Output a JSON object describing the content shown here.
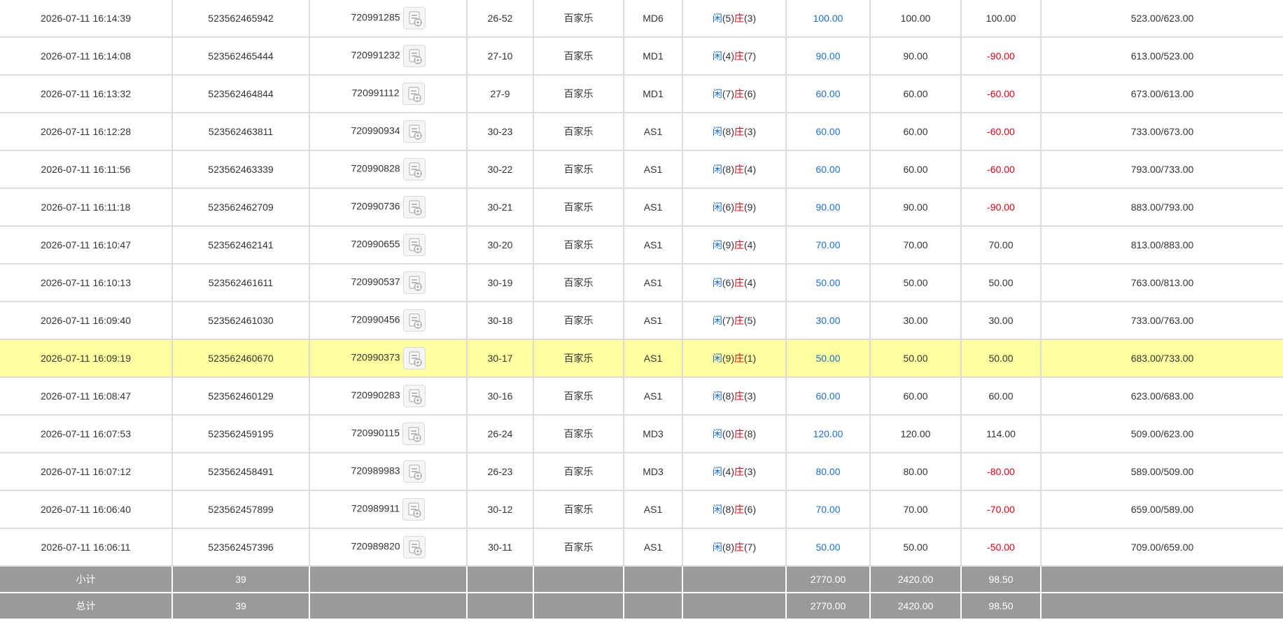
{
  "colors": {
    "player": "#1a6fd6",
    "banker": "#e60012",
    "highlight": "#ffffa0",
    "summary_bg": "#9a9a9a"
  },
  "icons": {
    "detail": "game-detail-icon"
  },
  "rows": [
    {
      "time": "2026-07-11 16:14:39",
      "bet_id": "523562465942",
      "round_id": "720991285",
      "shoe": "26-52",
      "game": "百家乐",
      "table": "MD6",
      "player_label": "闲",
      "player_score": "(5)",
      "banker_label": "庄",
      "banker_score": "(3)",
      "bet": "100.00",
      "valid_bet": "100.00",
      "win_loss": "100.00",
      "win_loss_negative": false,
      "balance": "523.00/623.00",
      "highlight": false
    },
    {
      "time": "2026-07-11 16:14:08",
      "bet_id": "523562465444",
      "round_id": "720991232",
      "shoe": "27-10",
      "game": "百家乐",
      "table": "MD1",
      "player_label": "闲",
      "player_score": "(4)",
      "banker_label": "庄",
      "banker_score": "(7)",
      "bet": "90.00",
      "valid_bet": "90.00",
      "win_loss": "-90.00",
      "win_loss_negative": true,
      "balance": "613.00/523.00",
      "highlight": false
    },
    {
      "time": "2026-07-11 16:13:32",
      "bet_id": "523562464844",
      "round_id": "720991112",
      "shoe": "27-9",
      "game": "百家乐",
      "table": "MD1",
      "player_label": "闲",
      "player_score": "(7)",
      "banker_label": "庄",
      "banker_score": "(6)",
      "bet": "60.00",
      "valid_bet": "60.00",
      "win_loss": "-60.00",
      "win_loss_negative": true,
      "balance": "673.00/613.00",
      "highlight": false
    },
    {
      "time": "2026-07-11 16:12:28",
      "bet_id": "523562463811",
      "round_id": "720990934",
      "shoe": "30-23",
      "game": "百家乐",
      "table": "AS1",
      "player_label": "闲",
      "player_score": "(8)",
      "banker_label": "庄",
      "banker_score": "(3)",
      "bet": "60.00",
      "valid_bet": "60.00",
      "win_loss": "-60.00",
      "win_loss_negative": true,
      "balance": "733.00/673.00",
      "highlight": false
    },
    {
      "time": "2026-07-11 16:11:56",
      "bet_id": "523562463339",
      "round_id": "720990828",
      "shoe": "30-22",
      "game": "百家乐",
      "table": "AS1",
      "player_label": "闲",
      "player_score": "(8)",
      "banker_label": "庄",
      "banker_score": "(4)",
      "bet": "60.00",
      "valid_bet": "60.00",
      "win_loss": "-60.00",
      "win_loss_negative": true,
      "balance": "793.00/733.00",
      "highlight": false
    },
    {
      "time": "2026-07-11 16:11:18",
      "bet_id": "523562462709",
      "round_id": "720990736",
      "shoe": "30-21",
      "game": "百家乐",
      "table": "AS1",
      "player_label": "闲",
      "player_score": "(6)",
      "banker_label": "庄",
      "banker_score": "(9)",
      "bet": "90.00",
      "valid_bet": "90.00",
      "win_loss": "-90.00",
      "win_loss_negative": true,
      "balance": "883.00/793.00",
      "highlight": false
    },
    {
      "time": "2026-07-11 16:10:47",
      "bet_id": "523562462141",
      "round_id": "720990655",
      "shoe": "30-20",
      "game": "百家乐",
      "table": "AS1",
      "player_label": "闲",
      "player_score": "(9)",
      "banker_label": "庄",
      "banker_score": "(4)",
      "bet": "70.00",
      "valid_bet": "70.00",
      "win_loss": "70.00",
      "win_loss_negative": false,
      "balance": "813.00/883.00",
      "highlight": false
    },
    {
      "time": "2026-07-11 16:10:13",
      "bet_id": "523562461611",
      "round_id": "720990537",
      "shoe": "30-19",
      "game": "百家乐",
      "table": "AS1",
      "player_label": "闲",
      "player_score": "(6)",
      "banker_label": "庄",
      "banker_score": "(4)",
      "bet": "50.00",
      "valid_bet": "50.00",
      "win_loss": "50.00",
      "win_loss_negative": false,
      "balance": "763.00/813.00",
      "highlight": false
    },
    {
      "time": "2026-07-11 16:09:40",
      "bet_id": "523562461030",
      "round_id": "720990456",
      "shoe": "30-18",
      "game": "百家乐",
      "table": "AS1",
      "player_label": "闲",
      "player_score": "(7)",
      "banker_label": "庄",
      "banker_score": "(5)",
      "bet": "30.00",
      "valid_bet": "30.00",
      "win_loss": "30.00",
      "win_loss_negative": false,
      "balance": "733.00/763.00",
      "highlight": false
    },
    {
      "time": "2026-07-11 16:09:19",
      "bet_id": "523562460670",
      "round_id": "720990373",
      "shoe": "30-17",
      "game": "百家乐",
      "table": "AS1",
      "player_label": "闲",
      "player_score": "(9)",
      "banker_label": "庄",
      "banker_score": "(1)",
      "bet": "50.00",
      "valid_bet": "50.00",
      "win_loss": "50.00",
      "win_loss_negative": false,
      "balance": "683.00/733.00",
      "highlight": true
    },
    {
      "time": "2026-07-11 16:08:47",
      "bet_id": "523562460129",
      "round_id": "720990283",
      "shoe": "30-16",
      "game": "百家乐",
      "table": "AS1",
      "player_label": "闲",
      "player_score": "(8)",
      "banker_label": "庄",
      "banker_score": "(3)",
      "bet": "60.00",
      "valid_bet": "60.00",
      "win_loss": "60.00",
      "win_loss_negative": false,
      "balance": "623.00/683.00",
      "highlight": false
    },
    {
      "time": "2026-07-11 16:07:53",
      "bet_id": "523562459195",
      "round_id": "720990115",
      "shoe": "26-24",
      "game": "百家乐",
      "table": "MD3",
      "player_label": "闲",
      "player_score": "(0)",
      "banker_label": "庄",
      "banker_score": "(8)",
      "bet": "120.00",
      "valid_bet": "120.00",
      "win_loss": "114.00",
      "win_loss_negative": false,
      "balance": "509.00/623.00",
      "highlight": false
    },
    {
      "time": "2026-07-11 16:07:12",
      "bet_id": "523562458491",
      "round_id": "720989983",
      "shoe": "26-23",
      "game": "百家乐",
      "table": "MD3",
      "player_label": "闲",
      "player_score": "(4)",
      "banker_label": "庄",
      "banker_score": "(3)",
      "bet": "80.00",
      "valid_bet": "80.00",
      "win_loss": "-80.00",
      "win_loss_negative": true,
      "balance": "589.00/509.00",
      "highlight": false
    },
    {
      "time": "2026-07-11 16:06:40",
      "bet_id": "523562457899",
      "round_id": "720989911",
      "shoe": "30-12",
      "game": "百家乐",
      "table": "AS1",
      "player_label": "闲",
      "player_score": "(8)",
      "banker_label": "庄",
      "banker_score": "(6)",
      "bet": "70.00",
      "valid_bet": "70.00",
      "win_loss": "-70.00",
      "win_loss_negative": true,
      "balance": "659.00/589.00",
      "highlight": false
    },
    {
      "time": "2026-07-11 16:06:11",
      "bet_id": "523562457396",
      "round_id": "720989820",
      "shoe": "30-11",
      "game": "百家乐",
      "table": "AS1",
      "player_label": "闲",
      "player_score": "(8)",
      "banker_label": "庄",
      "banker_score": "(7)",
      "bet": "50.00",
      "valid_bet": "50.00",
      "win_loss": "-50.00",
      "win_loss_negative": true,
      "balance": "709.00/659.00",
      "highlight": false
    }
  ],
  "subtotal": {
    "label": "小计",
    "count": "39",
    "bet": "2770.00",
    "valid_bet": "2420.00",
    "win_loss": "98.50"
  },
  "total": {
    "label": "总计",
    "count": "39",
    "bet": "2770.00",
    "valid_bet": "2420.00",
    "win_loss": "98.50"
  }
}
